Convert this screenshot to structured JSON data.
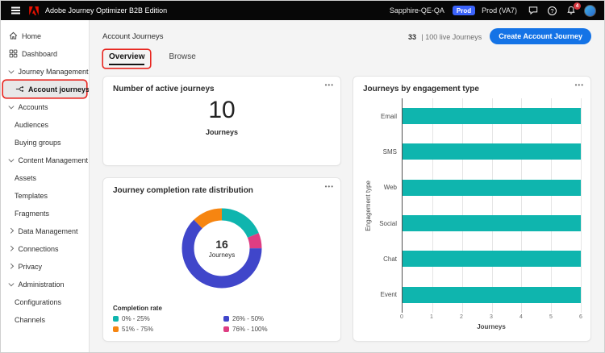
{
  "ui": {
    "more_glyph": "•••",
    "help_glyph": "?"
  },
  "colors": {
    "accent": "#1473e6",
    "annotation": "#e8251f"
  },
  "topbar": {
    "app_title": "Adobe Journey Optimizer B2B Edition",
    "org_name": "Sapphire-QE-QA",
    "env_badge": "Prod",
    "env_label": "Prod (VA7)",
    "notification_count": "4"
  },
  "sidebar": {
    "items": [
      {
        "label": "Home",
        "icon": "home"
      },
      {
        "label": "Dashboard",
        "icon": "dashboard"
      },
      {
        "label": "Journey Management",
        "chevron": "down"
      },
      {
        "label": "Account journeys",
        "icon": "journeys",
        "indent": 1,
        "selected": true,
        "annotated": true
      },
      {
        "label": "Accounts",
        "chevron": "down"
      },
      {
        "label": "Audiences",
        "indent": 1
      },
      {
        "label": "Buying groups",
        "indent": 1
      },
      {
        "label": "Content Management",
        "chevron": "down"
      },
      {
        "label": "Assets",
        "indent": 1
      },
      {
        "label": "Templates",
        "indent": 1
      },
      {
        "label": "Fragments",
        "indent": 1
      },
      {
        "label": "Data Management",
        "chevron": "right"
      },
      {
        "label": "Connections",
        "chevron": "right"
      },
      {
        "label": "Privacy",
        "chevron": "right"
      },
      {
        "label": "Administration",
        "chevron": "down"
      },
      {
        "label": "Configurations",
        "indent": 1
      },
      {
        "label": "Channels",
        "indent": 1
      }
    ]
  },
  "header": {
    "page_title": "Account Journeys",
    "live_count": "33",
    "live_label": "| 100 live Journeys",
    "create_button": "Create Account Journey"
  },
  "tabs": [
    {
      "label": "Overview",
      "active": true
    },
    {
      "label": "Browse",
      "active": false
    }
  ],
  "cards": {
    "active": {
      "title": "Number of active journeys",
      "value": "10",
      "unit": "Journeys"
    },
    "completion": {
      "title": "Journey completion rate distribution",
      "center_value": "16",
      "center_label": "Journeys",
      "legend_title": "Completion rate",
      "chart_data": {
        "type": "pie",
        "donut": true,
        "total": 16,
        "draw_order": [
          0,
          3,
          1,
          2
        ],
        "segments": [
          {
            "label": "0% - 25%",
            "value": 3,
            "color": "#0fb5ae"
          },
          {
            "label": "26% - 50%",
            "value": 10,
            "color": "#4046ca"
          },
          {
            "label": "51% - 75%",
            "value": 2,
            "color": "#f68511"
          },
          {
            "label": "76% - 100%",
            "value": 1,
            "color": "#de3d82"
          }
        ]
      }
    },
    "engagement": {
      "title": "Journeys by engagement type",
      "chart_data": {
        "type": "bar",
        "orientation": "horizontal",
        "categories": [
          "Email",
          "SMS",
          "Web",
          "Social",
          "Chat",
          "Event"
        ],
        "values": [
          6,
          6,
          6,
          6,
          6,
          6
        ],
        "bar_color": "#0fb5ae",
        "xlabel": "Journeys",
        "ylabel": "Engagement type",
        "xlim": [
          0,
          6
        ],
        "xticks": [
          0,
          1,
          2,
          3,
          4,
          5,
          6
        ],
        "grid": true,
        "legend": "none"
      }
    }
  }
}
